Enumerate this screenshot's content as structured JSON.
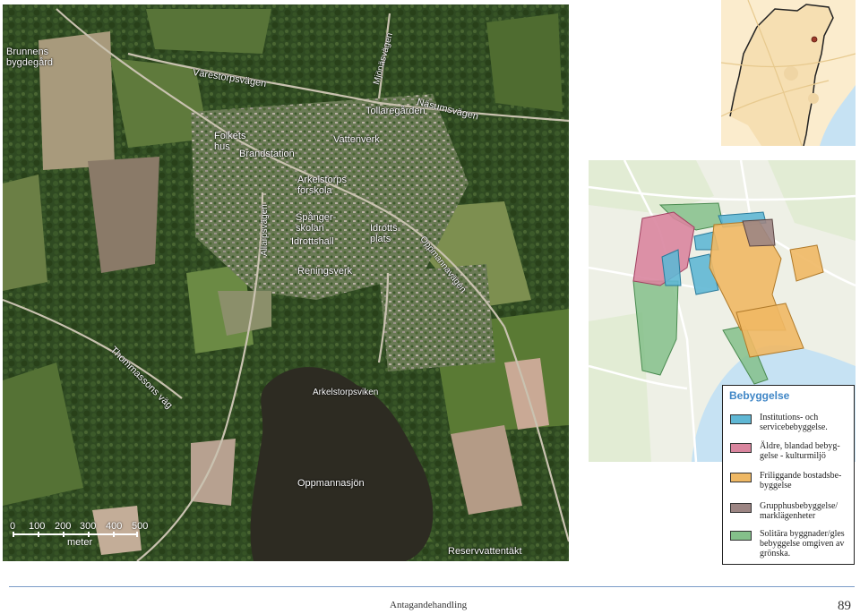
{
  "aerial_map": {
    "labels": {
      "brunnens": "Brunnens\nbygdegård",
      "varestorpsvagen": "Värestorpsvägen",
      "mjonasvagen": "Mjönäsvägen",
      "nasumsvagen": "Näsumsvägen",
      "tollaregarden": "Tollaregården",
      "folkets_hus": "Folkets\nhus",
      "brandstation": "Brandstation",
      "vattenverk": "Vattenverk",
      "arkelstorps_forskola": "Arkelstorps\nförskola",
      "allarpsvagen": "Allarpsvägen",
      "spangerskolan": "Spånger-\nskolan",
      "idrottshall": "Idrottshall",
      "idrottsplats": "Idrotts-\nplats",
      "oppmannavagen": "Oppmannavägen",
      "reningsverk": "Reningsverk",
      "thommassons_vag": "Thommassons väg",
      "arkelstorpsviken": "Arkelstorpsviken",
      "oppmannasjon": "Oppmannasjön",
      "reservvattentakt": "Reservvattentäkt"
    },
    "scale": {
      "ticks": [
        "0",
        "100",
        "200",
        "300",
        "400",
        "500"
      ],
      "unit": "meter"
    }
  },
  "legend": {
    "title": "Bebyggelse",
    "items": [
      {
        "label": "Institutions- och servicebebyggelse.",
        "color": "#5fb7d4"
      },
      {
        "label": "Äldre, blandad bebyg-gelse - kulturmiljö",
        "color": "#d9859e"
      },
      {
        "label": "Friliggande bostadsbe-byggelse",
        "color": "#efb864"
      },
      {
        "label": "Grupphusbebyggelse/ marklägenheter",
        "color": "#9c8583"
      },
      {
        "label": "Solitära byggnader/gles bebyggelse omgiven av grönska.",
        "color": "#84c08a"
      }
    ]
  },
  "colors": {
    "water": "#c6e2f3",
    "overview_land": "#fbeccd",
    "legend_title": "#3f86c6"
  },
  "footer": {
    "text": "Antagandehandling",
    "page": "89"
  }
}
